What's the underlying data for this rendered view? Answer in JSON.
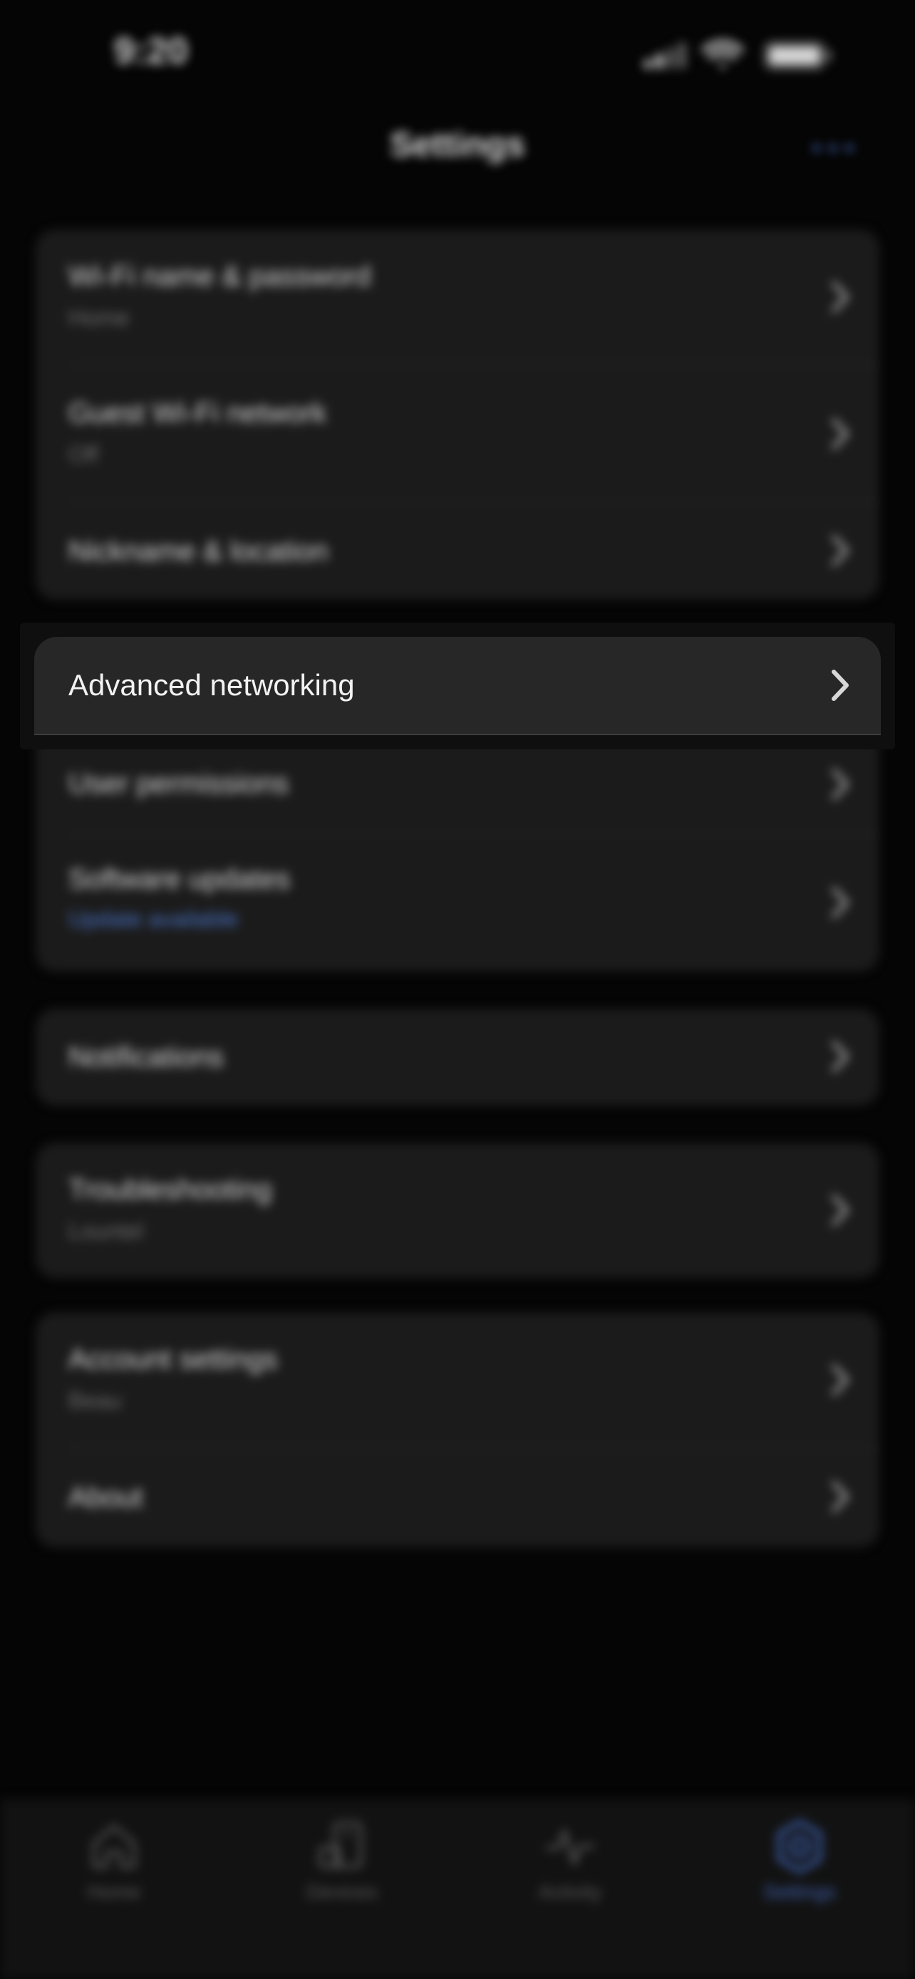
{
  "status_bar": {
    "time": "9:20",
    "icons": [
      "cellular-signal-icon",
      "wifi-icon",
      "battery-icon"
    ]
  },
  "header": {
    "title": "Settings",
    "more_icon": "ellipsis-icon"
  },
  "groups": [
    {
      "rows": [
        {
          "title": "Wi-Fi name & password",
          "subtitle": "Home"
        },
        {
          "title": "Guest Wi-Fi network",
          "subtitle": "Off"
        },
        {
          "title": "Nickname & location",
          "subtitle": ""
        }
      ]
    },
    {
      "rows": [
        {
          "title": "Advanced networking",
          "subtitle": "",
          "focused": true
        },
        {
          "title": "User permissions",
          "subtitle": ""
        },
        {
          "title": "Software updates",
          "subtitle": "Update available",
          "subtitle_accent": true
        }
      ]
    },
    {
      "rows": [
        {
          "title": "Notifications",
          "subtitle": ""
        }
      ]
    },
    {
      "rows": [
        {
          "title": "Troubleshooting",
          "subtitle": "Lountel"
        }
      ]
    },
    {
      "rows": [
        {
          "title": "Account settings",
          "subtitle": "Beau"
        },
        {
          "title": "About",
          "subtitle": ""
        }
      ]
    }
  ],
  "tabbar": {
    "tabs": [
      {
        "label": "Home",
        "icon": "home-icon",
        "active": false
      },
      {
        "label": "Devices",
        "icon": "devices-icon",
        "active": false
      },
      {
        "label": "Activity",
        "icon": "activity-icon",
        "active": false
      },
      {
        "label": "Settings",
        "icon": "settings-icon",
        "active": true
      }
    ]
  },
  "colors": {
    "background": "#050505",
    "card": "#1b1b1b",
    "focused_row": "#272727",
    "accent": "#3f63b3",
    "text_primary": "#e9e9e9",
    "text_secondary": "#6d6d6d"
  }
}
